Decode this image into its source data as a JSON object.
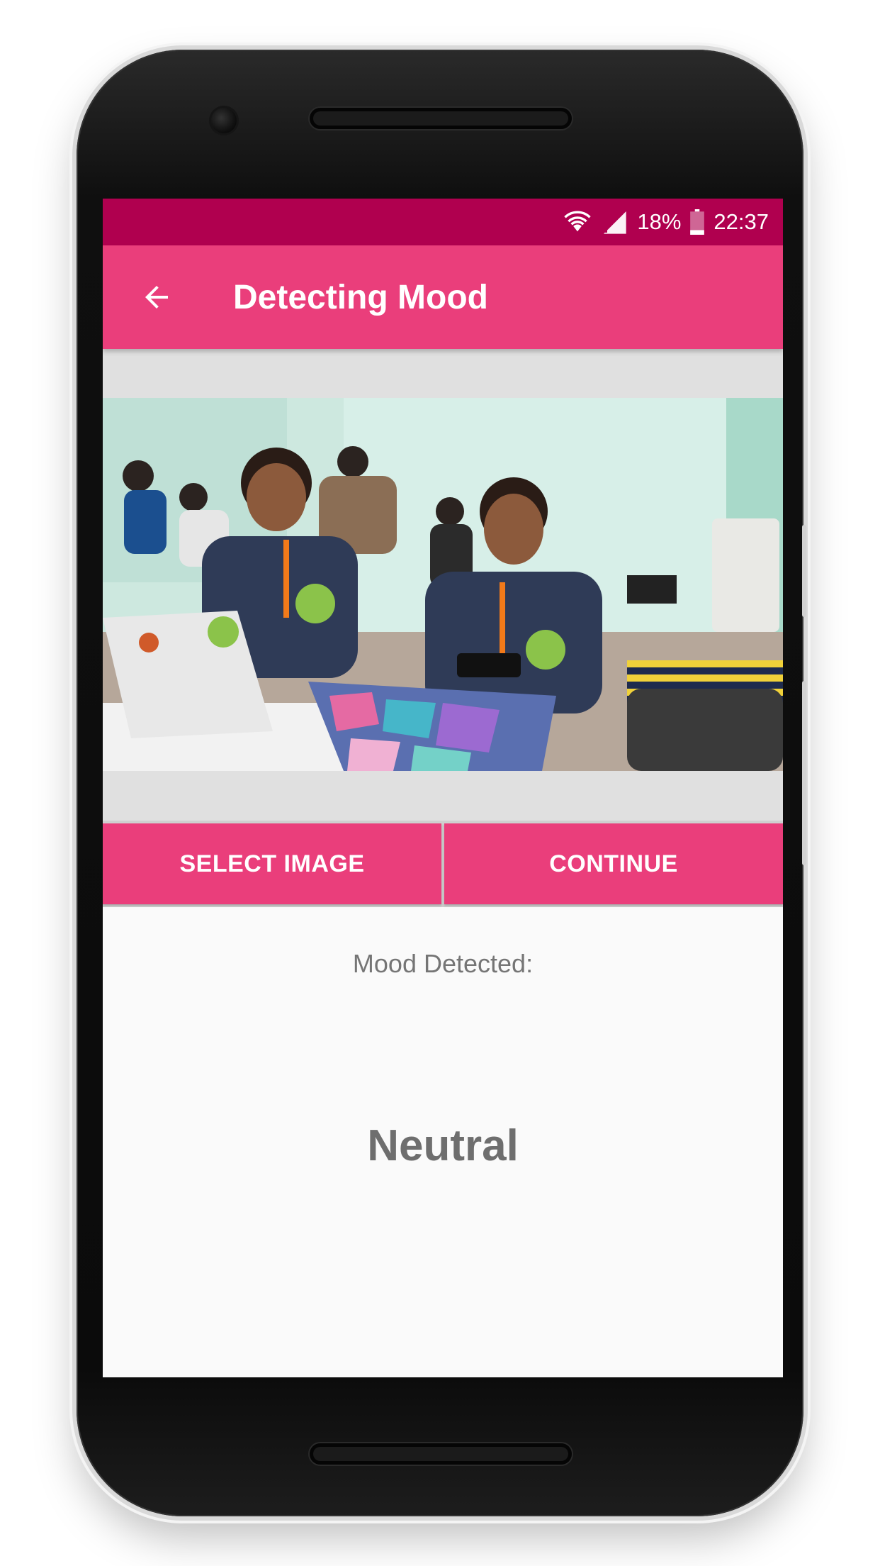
{
  "status_bar": {
    "battery": "18%",
    "time": "22:37",
    "icons": [
      "wifi-icon",
      "signal-icon",
      "battery-icon"
    ]
  },
  "app_bar": {
    "title": "Detecting Mood",
    "back_icon": "arrow-back-icon"
  },
  "image": {
    "description_icon": "selected-photo"
  },
  "buttons": {
    "select_image": "SELECT IMAGE",
    "continue": "CONTINUE"
  },
  "result": {
    "label": "Mood Detected:",
    "value": "Neutral"
  },
  "colors": {
    "status_bar": "#b0004f",
    "primary": "#ea3e7b",
    "background": "#fafafa",
    "text_secondary": "#757575"
  }
}
